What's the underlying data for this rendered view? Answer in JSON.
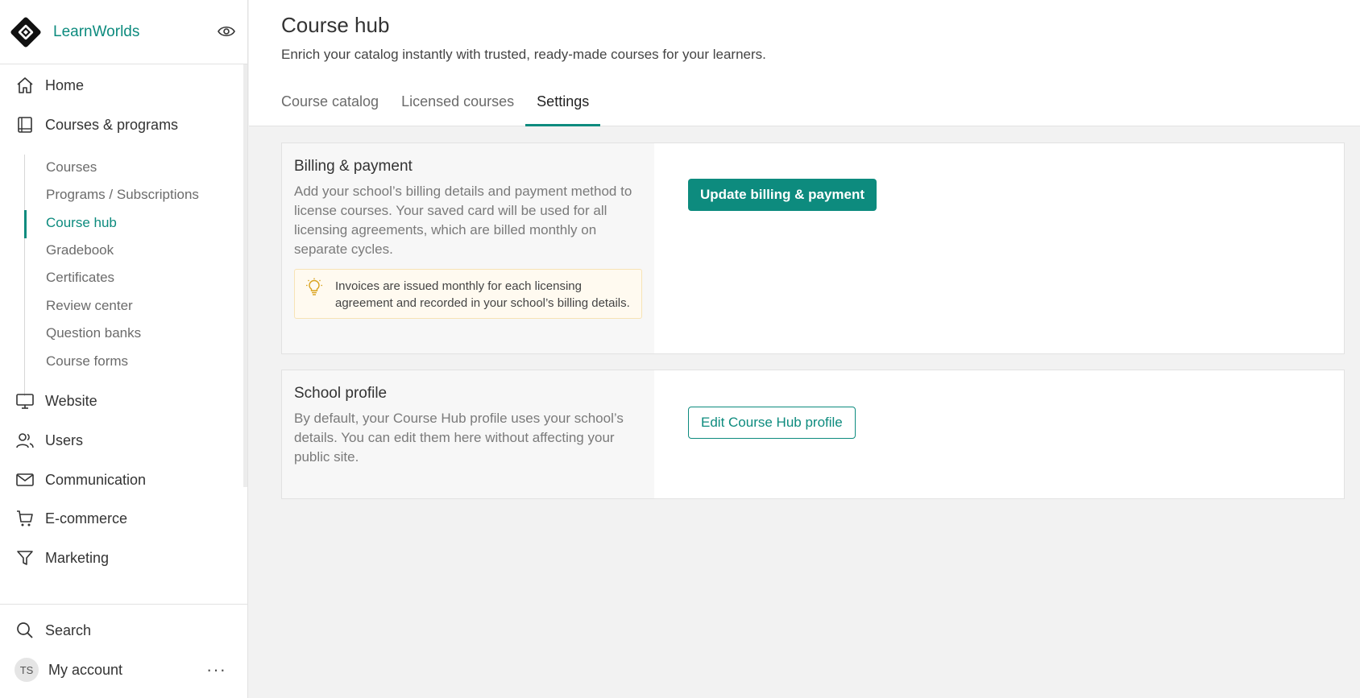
{
  "sidebar": {
    "brand_name": "LearnWorlds",
    "nav": {
      "home": "Home",
      "courses_programs": "Courses & programs",
      "website": "Website",
      "users": "Users",
      "communication": "Communication",
      "ecommerce": "E-commerce",
      "marketing": "Marketing"
    },
    "subnav": {
      "courses": "Courses",
      "programs": "Programs / Subscriptions",
      "course_hub": "Course hub",
      "gradebook": "Gradebook",
      "certificates": "Certificates",
      "review_center": "Review center",
      "question_banks": "Question banks",
      "course_forms": "Course forms"
    },
    "bottom": {
      "search": "Search",
      "avatar_initials": "TS",
      "my_account": "My account",
      "more": "···"
    }
  },
  "header": {
    "title": "Course hub",
    "subtitle": "Enrich your catalog instantly with trusted, ready-made courses for your learners.",
    "tabs": {
      "catalog": "Course catalog",
      "licensed": "Licensed courses",
      "settings": "Settings"
    }
  },
  "billing": {
    "title": "Billing & payment",
    "description": "Add your school’s billing details and payment method to license courses. Your saved card will be used for all licensing agreements, which are billed monthly on separate cycles.",
    "tip": "Invoices are issued monthly for each licensing agreement and recorded in your school’s billing details.",
    "button": "Update billing & payment"
  },
  "profile": {
    "title": "School profile",
    "description": "By default, your Course Hub profile uses your school’s details. You can edit them here without affecting your public site.",
    "button": "Edit Course Hub profile"
  },
  "colors": {
    "accent": "#0d8b7e",
    "tip_bg": "#fffaf0",
    "tip_border": "#f7e3b5"
  }
}
